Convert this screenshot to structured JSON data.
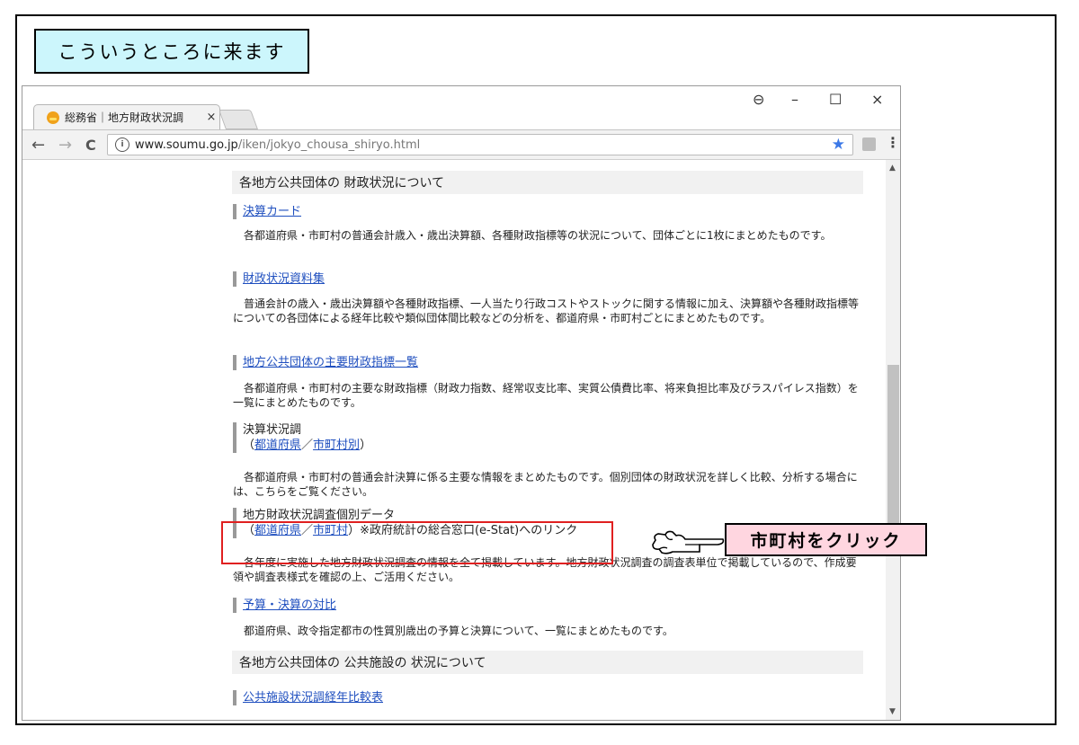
{
  "callouts": {
    "top": "こういうところに来ます",
    "click": "市町村をクリック"
  },
  "browser": {
    "tab_title": "総務省｜地方財政状況調",
    "tab_close": "×",
    "url_host": "www.soumu.go.jp",
    "url_path": "/iken/jokyo_chousa_shiryo.html",
    "url_info_icon": "ⓘ",
    "controls": {
      "account": "⊖",
      "minimize": "–",
      "maximize": "☐",
      "close": "×"
    },
    "nav": {
      "back": "←",
      "forward": "→",
      "reload": "C"
    },
    "star": "★",
    "menu": "⋮"
  },
  "page": {
    "section1_title": "各地方公共団体の 財政状況について",
    "items": [
      {
        "title": "決算カード",
        "desc": "各都道府県・市町村の普通会計歳入・歳出決算額、各種財政指標等の状況について、団体ごとに1枚にまとめたものです。"
      },
      {
        "title": "財政状況資料集",
        "desc": "普通会計の歳入・歳出決算額や各種財政指標、一人当たり行政コストやストックに関する情報に加え、決算額や各種財政指標等についての各団体による経年比較や類似団体間比較などの分析を、都道府県・市町村ごとにまとめたものです。"
      },
      {
        "title": "地方公共団体の主要財政指標一覧",
        "desc": "各都道府県・市町村の主要な財政指標（財政力指数、経常収支比率、実質公債費比率、将来負担比率及びラスパイレス指数）を一覧にまとめたものです。"
      },
      {
        "title": "決算状況調",
        "sub_open": "（",
        "sub_link1": "都道府県",
        "sub_sep": "／",
        "sub_link2": "市町村別",
        "sub_close": "）",
        "desc": "各都道府県・市町村の普通会計決算に係る主要な情報をまとめたものです。個別団体の財政状況を詳しく比較、分析する場合には、こちらをご覧ください。"
      },
      {
        "title": "地方財政状況調査個別データ",
        "sub_open": "（",
        "sub_link1": "都道府県",
        "sub_sep": "／",
        "sub_link2": "市町村",
        "sub_close": "）※政府統計の総合窓口(e-Stat)へのリンク",
        "desc": "各年度に実施した地方財政状況調査の情報を全て掲載しています。地方財政状況調査の調査表単位で掲載しているので、作成要領や調査表様式を確認の上、ご活用ください。"
      },
      {
        "title": "予算・決算の対比",
        "desc": "都道府県、政令指定都市の性質別歳出の予算と決算について、一覧にまとめたものです。"
      }
    ],
    "section2_title": "各地方公共団体の 公共施設の 状況について",
    "section2_item": "公共施設状況調経年比較表"
  }
}
